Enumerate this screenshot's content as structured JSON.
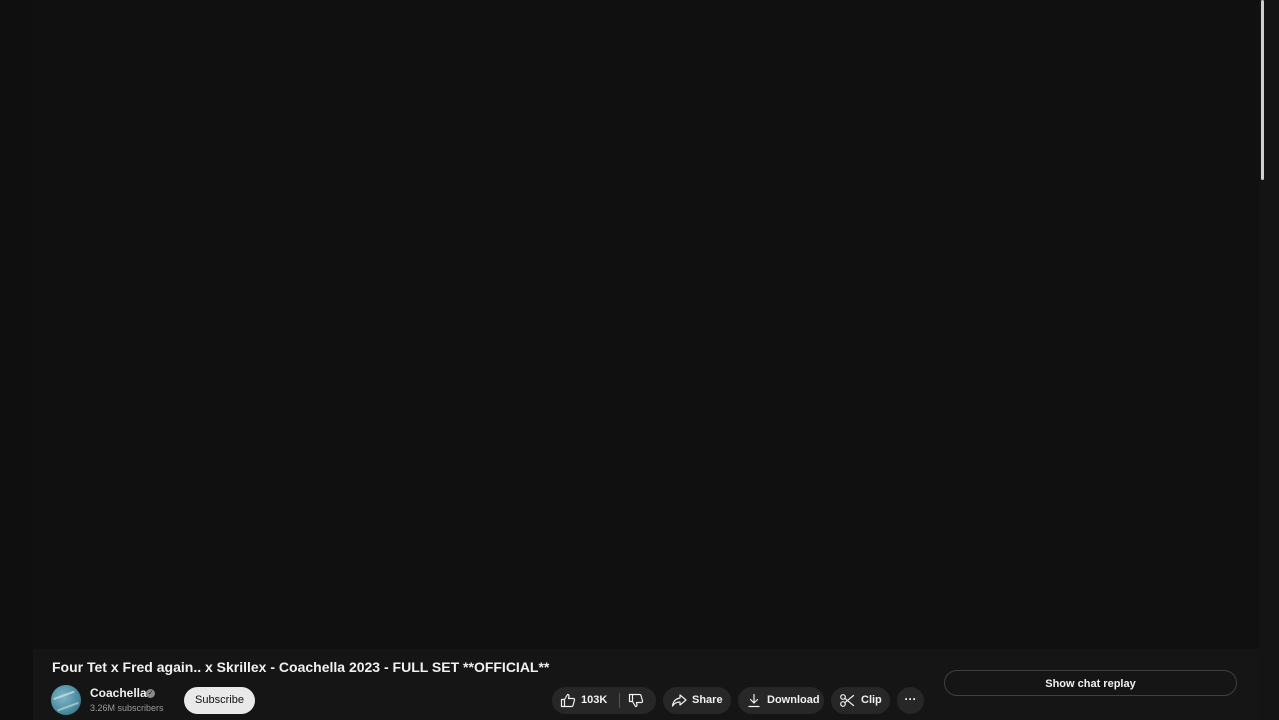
{
  "video": {
    "title": "Four Tet x Fred again.. x Skrillex - Coachella 2023 - FULL SET **OFFICIAL**"
  },
  "channel": {
    "name": "Coachella",
    "subscribers": "3.26M subscribers",
    "subscribe_label": "Subscribe",
    "verified_icon": "check-circle-icon"
  },
  "actions": {
    "like_count": "103K",
    "share_label": "Share",
    "download_label": "Download",
    "clip_label": "Clip",
    "more_label": "···"
  },
  "chat": {
    "show_replay_label": "Show chat replay"
  },
  "colors": {
    "background": "#121212",
    "pill": "#272727",
    "subscribe_bg": "#e9e9e9",
    "text": "#f1f1f1"
  }
}
